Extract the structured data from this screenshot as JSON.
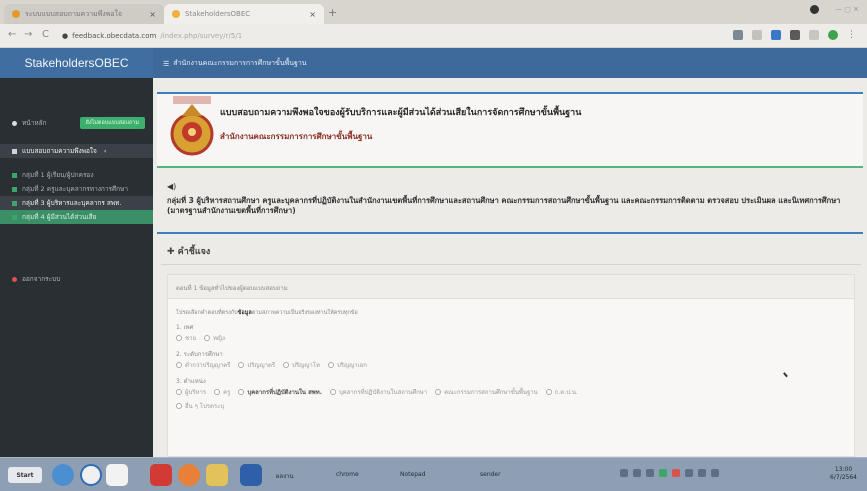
{
  "browser": {
    "tabs": [
      {
        "label": "ระบบแบบสอบถามความพึงพอใจ"
      },
      {
        "label": "StakeholdersOBEC"
      }
    ],
    "new_tab_symbol": "+",
    "url": {
      "host": "feedback.obecdata.com",
      "path": "/index.php/survey/r/5/1"
    }
  },
  "site": {
    "brand": "StakeholdersOBEC",
    "topnav_label": "สำนักงานคณะกรรมการการศึกษาขั้นพื้นฐาน"
  },
  "sidebar": {
    "items": [
      {
        "label": "หน้าหลัก",
        "badge": "ยังไม่ตอบแบบสอบถาม"
      },
      {
        "label": "แบบสอบถามความพึงพอใจ"
      },
      {
        "label": "กลุ่มที่ 1 ผู้เรียน/ผู้ปกครอง"
      },
      {
        "label": "กลุ่มที่ 2 ครูและบุคลากรทางการศึกษา"
      },
      {
        "label": "กลุ่มที่ 3 ผู้บริหารและบุคลากร สพท."
      },
      {
        "label": "กลุ่มที่ 4 ผู้มีส่วนได้ส่วนเสีย"
      },
      {
        "label": "ออกจากระบบ"
      }
    ]
  },
  "header": {
    "title": "แบบสอบถามความพึงพอใจของผู้รับบริการและผู้มีส่วนได้ส่วนเสียในการจัดการศึกษาขั้นพื้นฐาน",
    "subtitle": "สำนักงานคณะกรรมการการศึกษาขั้นพื้นฐาน"
  },
  "intro": {
    "speaker_icon": "speaker-icon",
    "text": "กลุ่มที่ 3 ผู้บริหารสถานศึกษา ครูและบุคลากรที่ปฏิบัติงานในสำนักงานเขตพื้นที่การศึกษาและสถานศึกษา คณะกรรมการสถานศึกษาขั้นพื้นฐาน และคณะกรรมการติดตาม ตรวจสอบ ประเมินผล และนิเทศการศึกษา (มาตรฐานสำนักงานเขตพื้นที่การศึกษา)"
  },
  "explanation": {
    "title": "✚ คำชี้แจง",
    "panel_header": "ตอนที่ 1 ข้อมูลทั่วไปของผู้ตอบแบบสอบถาม",
    "instruction_prefix": "โปรดเลือกคำตอบที่ตรงกับ",
    "instruction_bold": "ข้อมูล",
    "instruction_suffix": "ตามสภาพความเป็นจริงของท่านให้ครบทุกข้อ",
    "questions": [
      {
        "label": "1. เพศ",
        "options": [
          "ชาย",
          "หญิง"
        ]
      },
      {
        "label": "2. ระดับการศึกษา",
        "options": [
          "ต่ำกว่าปริญญาตรี",
          "ปริญญาตรี",
          "ปริญญาโท",
          "ปริญญาเอก"
        ]
      },
      {
        "label": "3. ตำแหน่ง",
        "options": [
          "ผู้บริหาร",
          "ครู",
          "บุคลากรที่ปฏิบัติงานใน สพท.",
          "บุคลากรที่ปฏิบัติงานในสถานศึกษา",
          "คณะกรรมการสถานศึกษาขั้นพื้นฐาน",
          "ก.ต.ป.น."
        ]
      },
      {
        "label": "",
        "options": [
          "อื่น ๆ โปรดระบุ"
        ]
      }
    ]
  },
  "taskbar": {
    "start_label": "Start",
    "items": [
      "ผลงาน",
      "chrome",
      "Notepad",
      "sender"
    ],
    "clock_time": "13:00",
    "clock_date": "6/7/2564"
  },
  "colors": {
    "brand_blue": "#3d6a9a",
    "sidebar_dark": "#2a2f33",
    "accent_green": "#3bb06d",
    "heading_red": "#8a2f24"
  }
}
